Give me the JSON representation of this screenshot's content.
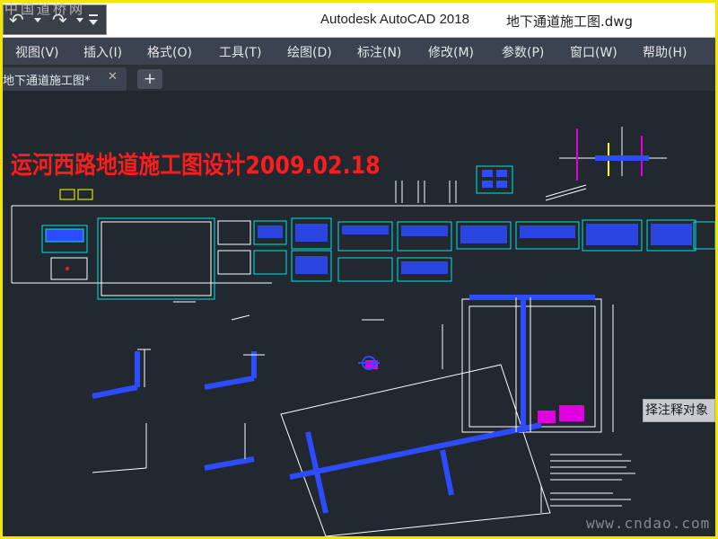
{
  "window": {
    "app_title": "Autodesk AutoCAD 2018",
    "document_title": "地下通道施工图.dwg"
  },
  "quick_access": {
    "undo_icon": "undo-icon",
    "redo_icon": "redo-icon",
    "customize_icon": "customize-dropdown-icon"
  },
  "watermarks": {
    "top_left": "中国道桥网",
    "bottom_right": "www.cndao.com"
  },
  "menu": {
    "items": [
      {
        "label": "视图(V)"
      },
      {
        "label": "插入(I)"
      },
      {
        "label": "格式(O)"
      },
      {
        "label": "工具(T)"
      },
      {
        "label": "绘图(D)"
      },
      {
        "label": "标注(N)"
      },
      {
        "label": "修改(M)"
      },
      {
        "label": "参数(P)"
      },
      {
        "label": "窗口(W)"
      },
      {
        "label": "帮助(H)"
      }
    ]
  },
  "tabs": {
    "active_label": "地下通道施工图*",
    "close_glyph": "✕",
    "new_tab_glyph": "+"
  },
  "drawing": {
    "title": "运河西路地道施工图设计2009.02.18",
    "tooltip": "择注释对象"
  },
  "colors": {
    "canvas_bg": "#212830",
    "title_red": "#ff1c1c",
    "cad_white": "#ffffff",
    "cad_cyan": "#00e5e5",
    "cad_blue": "#2d4bff",
    "cad_magenta": "#e000e0",
    "cad_yellow": "#ffff00",
    "border_yellow": "#f5e600"
  }
}
